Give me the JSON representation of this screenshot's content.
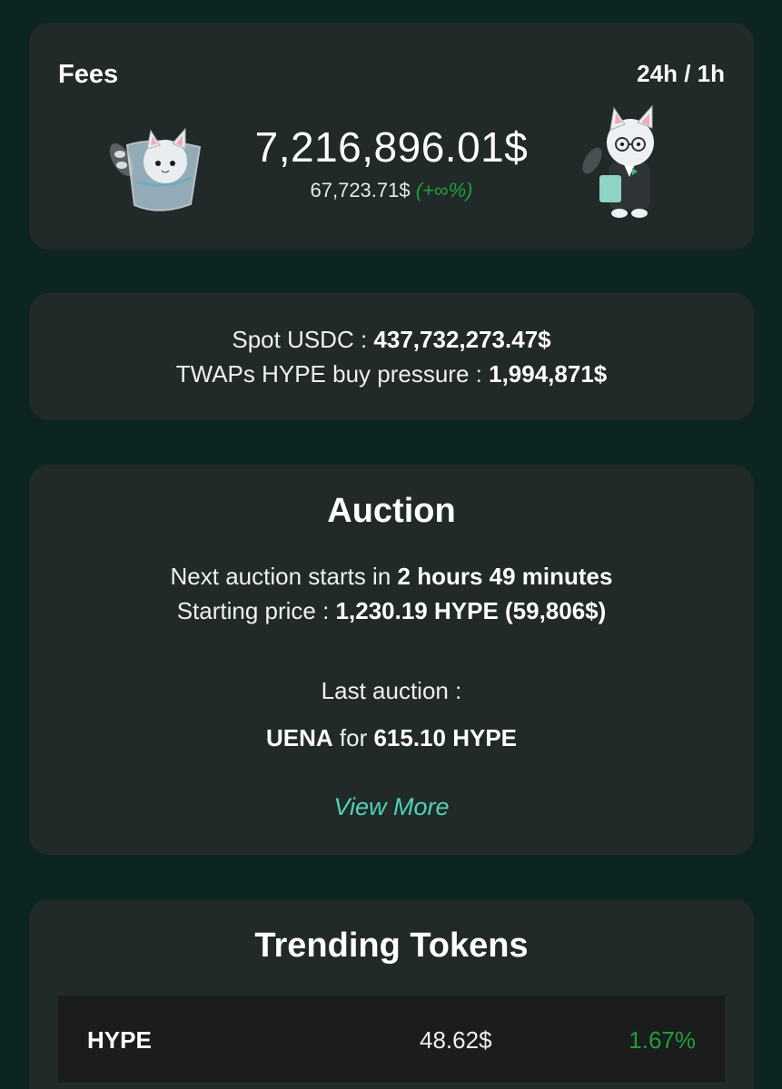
{
  "fees": {
    "title": "Fees",
    "timeframe": "24h / 1h",
    "amount": "7,216,896.01$",
    "sub_amount": "67,723.71$",
    "sub_change": "(+∞%)"
  },
  "spot": {
    "usdc_label": "Spot USDC : ",
    "usdc_value": "437,732,273.47$",
    "twap_label": "TWAPs HYPE buy pressure : ",
    "twap_value": "1,994,871$"
  },
  "auction": {
    "title": "Auction",
    "next_label": "Next auction starts in ",
    "next_value": "2 hours 49 minutes",
    "price_label": "Starting price : ",
    "price_value": "1,230.19 HYPE (59,806$)",
    "last_label": "Last auction :",
    "last_token": "UENA",
    "last_for": " for ",
    "last_amount": "615.10 HYPE",
    "view_more": "View More"
  },
  "trending": {
    "title": "Trending Tokens",
    "tokens": [
      {
        "name": "HYPE",
        "price": "48.62$",
        "change": "1.67%"
      }
    ]
  },
  "colors": {
    "background": "#0d2520",
    "card": "#212a28",
    "positive": "#1f9e3a",
    "link": "#4fd1b8"
  }
}
